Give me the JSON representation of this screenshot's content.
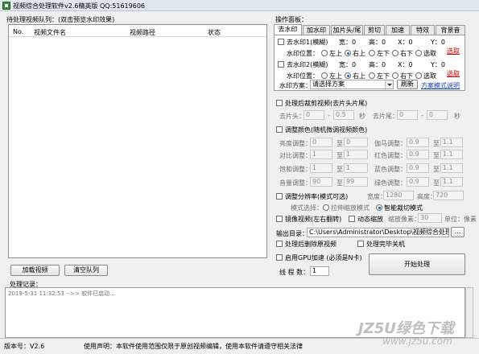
{
  "window": {
    "title": "视频综合处理软件v2.6精英版  QQ:51619606"
  },
  "queue": {
    "label": "待处理视频队列：(双击预览水印效果)",
    "columns": [
      "No.",
      "视频文件名",
      "视频路径",
      "状态"
    ],
    "add_button": "加载视频",
    "clear_button": "清空队列"
  },
  "panel": {
    "label": "操作面板：",
    "tabs": [
      "去水印",
      "加水印",
      "加片头/尾",
      "剪切",
      "加速",
      "特效",
      "背景音"
    ],
    "active_tab": 0,
    "wm1": {
      "label": "去水印1(模糊)",
      "w": "宽：0",
      "h": "高：0",
      "x": "X：0",
      "y": "Y：0",
      "pos_label": "水印位置：",
      "pos_options": [
        "左上",
        "右上",
        "左下",
        "右下",
        "选取"
      ],
      "selected": 1,
      "pick_link": "选取"
    },
    "wm2": {
      "label": "去水印2(模糊)",
      "w": "宽：0",
      "h": "高：0",
      "x": "X：0",
      "y": "Y：0",
      "pos_label": "水印位置：",
      "pos_options": [
        "左上",
        "右上",
        "左下",
        "右下",
        "选取"
      ],
      "selected": 1,
      "pick_link": "选取"
    },
    "scheme_label": "水印方案：",
    "scheme_value": "请选择方案",
    "refresh_button": "刷新",
    "scheme_help": "方案模式说明"
  },
  "cut": {
    "label": "处理后裁剪视频(去片头片尾)",
    "head_label": "去片头：",
    "head_start": "0",
    "head_sep": "-",
    "head_end": "0.5",
    "head_unit": "秒",
    "tail_label": "去片尾：",
    "tail_start": "0",
    "tail_sep": "-",
    "tail_end": "0",
    "tail_unit": "秒"
  },
  "color": {
    "label": "调整颜色(随机微调视频颜色)",
    "to": "至",
    "rows": [
      {
        "label": "亮度调整：",
        "from": "0",
        "to": "0",
        "label2": "伽马调整：",
        "from2": "0.9",
        "to2": "1.1"
      },
      {
        "label": "对比调整：",
        "from": "1",
        "to": "1",
        "label2": "红色调整：",
        "from2": "0.9",
        "to2": "1.1"
      },
      {
        "label": "饱和调整：",
        "from": "1",
        "to": "1",
        "label2": "蓝色调整：",
        "from2": "0.9",
        "to2": "1.1"
      },
      {
        "label": "音量调整：",
        "from": "90",
        "to": "99",
        "label2": "绿色调整：",
        "from2": "0.9",
        "to2": "1.1"
      }
    ]
  },
  "resolution": {
    "label": "调整分辨率(模式可选)",
    "width_label": "宽度：",
    "width": "1280",
    "height_label": "高度：",
    "height": "720",
    "mode_label": "模式选择：",
    "mode_options": [
      "拉伸缩放模式",
      "智能裁切模式"
    ],
    "mode_selected": 1
  },
  "effects": {
    "mirror": "镜像视频(左右翻转)",
    "dynamic_zoom": "动态缩放",
    "zoom_label": "缩放像素：",
    "zoom_value": "30",
    "zoom_unit": "单位：像素"
  },
  "output": {
    "label": "输出目录：",
    "path": "C:\\Users\\Administrator\\Desktop\\视频综合处理",
    "browse": "..."
  },
  "options": {
    "delete_original": "处理后删除原视频",
    "shutdown": "处理完毕关机",
    "gpu": "启用GPU加速 (必须是N卡)",
    "threads_label": "线 程 数：",
    "threads_value": "1",
    "start_button": "开始处理"
  },
  "log": {
    "label": "处理记录：",
    "entries": [
      "2019-5-31 11:32:53 -->> 软件已启动..."
    ]
  },
  "status": {
    "version": "版本号：V2.6",
    "disclaimer": "使用声明：本软件使用范围仅限于原创视频编辑，使用本软件请遵守相关法律"
  },
  "watermark": {
    "line1": "JZ5U绿色下载",
    "line2": "www.jz5u.com"
  }
}
